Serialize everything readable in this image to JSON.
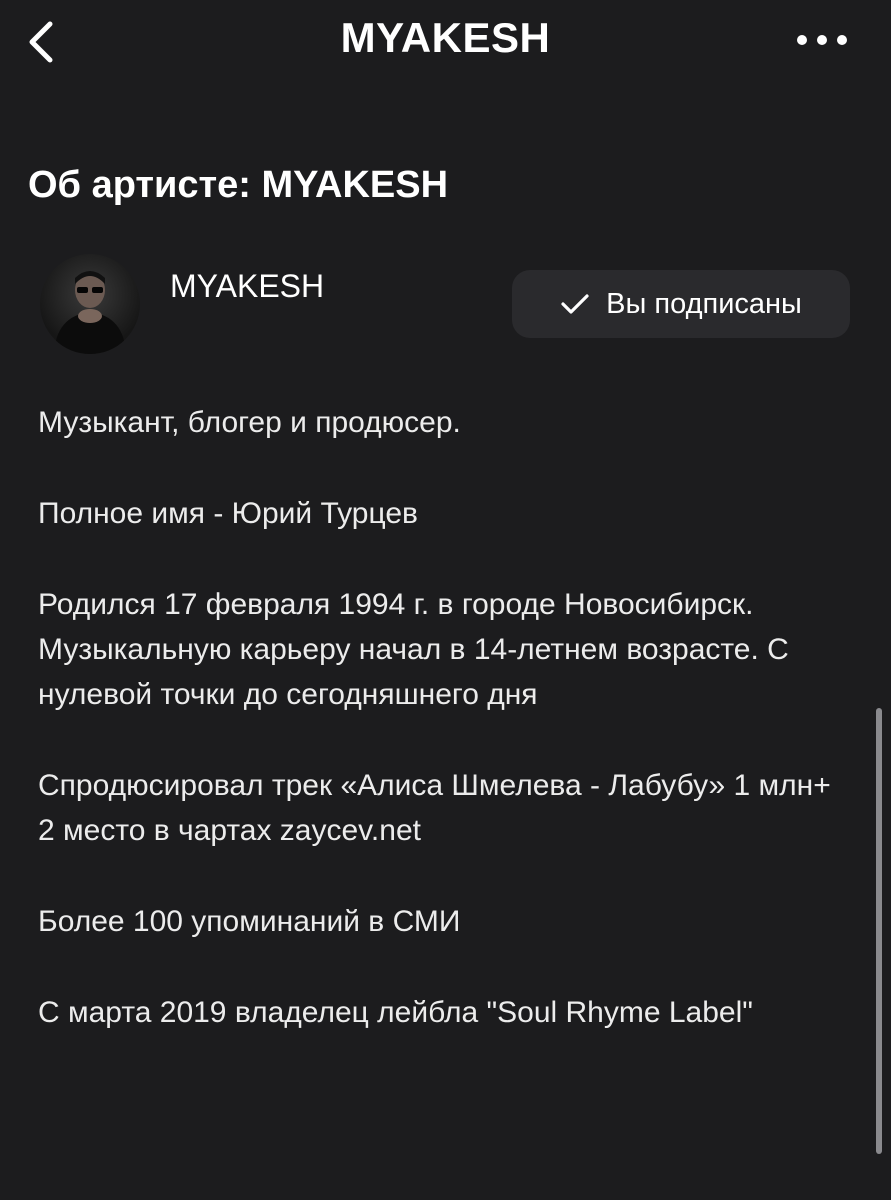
{
  "header": {
    "title": "MYAKESH",
    "back_icon": "chevron-left-icon",
    "more_icon": "ellipsis-icon"
  },
  "section": {
    "title": "Об артисте: MYAKESH"
  },
  "artist": {
    "name": "MYAKESH",
    "subscribe_label": "Вы подписаны",
    "subscribe_icon": "checkmark-icon"
  },
  "bio": {
    "p1": "Музыкант, блогер и продюсер.",
    "p2": "Полное имя - Юрий Турцев",
    "p3": "Родился 17 февраля 1994 г. в городе Новосибирск. Музыкальную карьеру начал в 14-летнем возрасте. С нулевой точки до сегодняшнего дня",
    "p4": "Спродюсировал трек «Алиса Шмелева - Лабубу» 1 млн+  2 место в чартах zaycev.net",
    "p5": "Более 100 упоминаний в СМИ",
    "p6": "С марта 2019 владелец лейбла \"Soul Rhyme Label\""
  },
  "colors": {
    "background": "#1c1c1e",
    "button_background": "#2a2a2d",
    "text": "#ffffff"
  }
}
